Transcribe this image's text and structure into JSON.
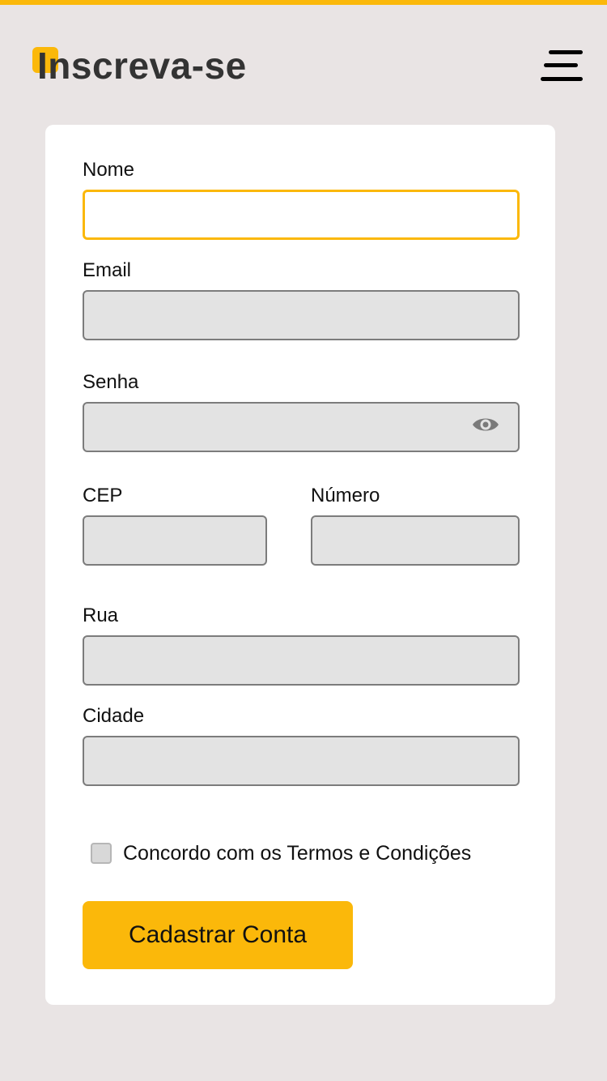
{
  "header": {
    "title": "Inscreva-se",
    "menu_icon": "hamburger-menu-icon"
  },
  "form": {
    "name": {
      "label": "Nome",
      "value": "",
      "placeholder": ""
    },
    "email": {
      "label": "Email",
      "value": "",
      "placeholder": ""
    },
    "password": {
      "label": "Senha",
      "value": "",
      "placeholder": "",
      "toggle_icon": "eye-icon"
    },
    "cep": {
      "label": "CEP",
      "value": "",
      "placeholder": ""
    },
    "number": {
      "label": "Número",
      "value": "",
      "placeholder": ""
    },
    "street": {
      "label": "Rua",
      "value": "",
      "placeholder": ""
    },
    "city": {
      "label": "Cidade",
      "value": "",
      "placeholder": ""
    },
    "terms": {
      "label": "Concordo com os Termos e Condições",
      "checked": false
    },
    "submit_label": "Cadastrar Conta"
  },
  "colors": {
    "accent": "#fbb80a",
    "background": "#e9e4e4",
    "card": "#ffffff",
    "input_fill": "#e3e3e3"
  }
}
